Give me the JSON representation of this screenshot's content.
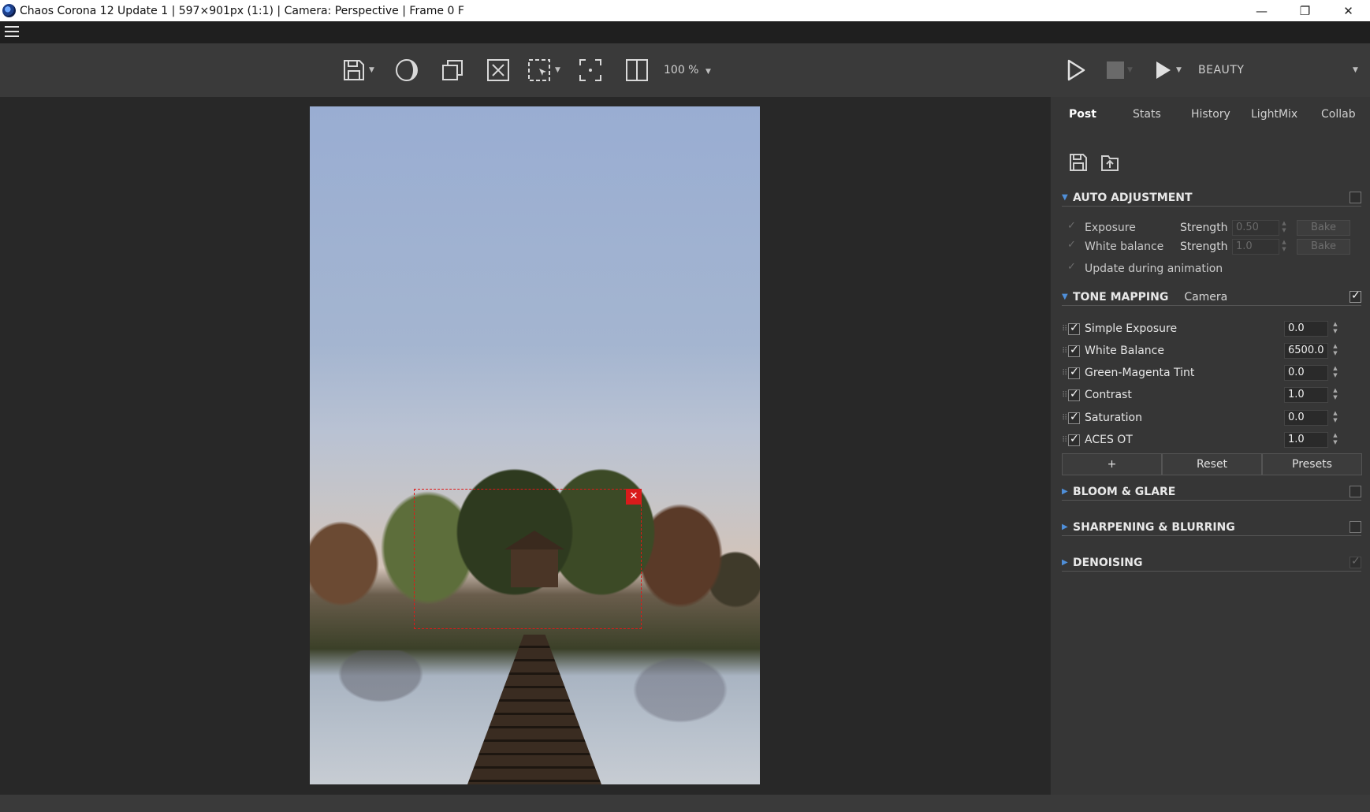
{
  "window": {
    "title": "Chaos Corona 12 Update 1 | 597×901px (1:1) | Camera: Perspective | Frame 0 F",
    "minimize": "—",
    "restore": "❐",
    "close": "✕"
  },
  "toolbar": {
    "zoom": "100 %",
    "pass": "BEAUTY",
    "caret": "▼"
  },
  "viewport": {
    "region_close": "✕"
  },
  "panel": {
    "tabs": [
      "Post",
      "Stats",
      "History",
      "LightMix",
      "Collab"
    ],
    "active_tab": "Post",
    "auto_adjustment": {
      "title": "AUTO ADJUSTMENT",
      "exposure_label": "Exposure",
      "exposure_strength_label": "Strength",
      "exposure_strength": "0.50",
      "white_balance_label": "White balance",
      "wb_strength_label": "Strength",
      "wb_strength": "1.0",
      "bake_label": "Bake",
      "update_label": "Update during animation"
    },
    "tone_mapping": {
      "title": "TONE MAPPING",
      "preset": "Camera",
      "operators": [
        {
          "label": "Simple Exposure",
          "value": "0.0"
        },
        {
          "label": "White Balance",
          "value": "6500.0"
        },
        {
          "label": "Green-Magenta Tint",
          "value": "0.0"
        },
        {
          "label": "Contrast",
          "value": "1.0"
        },
        {
          "label": "Saturation",
          "value": "0.0"
        },
        {
          "label": "ACES OT",
          "value": "1.0"
        }
      ],
      "add_label": "+",
      "reset_label": "Reset",
      "presets_label": "Presets"
    },
    "bloom_title": "BLOOM & GLARE",
    "sharpen_title": "SHARPENING & BLURRING",
    "denoise_title": "DENOISING"
  },
  "colors": {
    "accent": "#4f8fd9",
    "region": "#e01818"
  }
}
